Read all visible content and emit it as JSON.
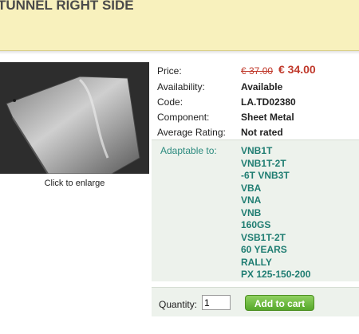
{
  "page": {
    "title": "TUNNEL RIGHT SIDE"
  },
  "image": {
    "caption": "Click to enlarge"
  },
  "details": {
    "price_label": "Price:",
    "old_price": "€ 37.00",
    "new_price": "€ 34.00",
    "availability_label": "Availability:",
    "availability": "Available",
    "code_label": "Code:",
    "code": "LA.TD02380",
    "component_label": "Component:",
    "component": "Sheet Metal",
    "rating_label": "Average Rating:",
    "rating": "Not rated"
  },
  "adaptable": {
    "label": "Adaptable to:",
    "models": [
      "VNB1T",
      "VNB1T-2T",
      "-6T VNB3T",
      "VBA",
      "VNA",
      "VNB",
      "160GS",
      "VSB1T-2T",
      "60 YEARS",
      "RALLY",
      "PX 125-150-200"
    ]
  },
  "cart": {
    "quantity_label": "Quantity:",
    "quantity": "1",
    "add_label": "Add to cart"
  },
  "colors": {
    "header_bg": "#f8f1bd",
    "price": "#c0392b",
    "adapt_text": "#1f7d72",
    "button": "#56a82b"
  }
}
